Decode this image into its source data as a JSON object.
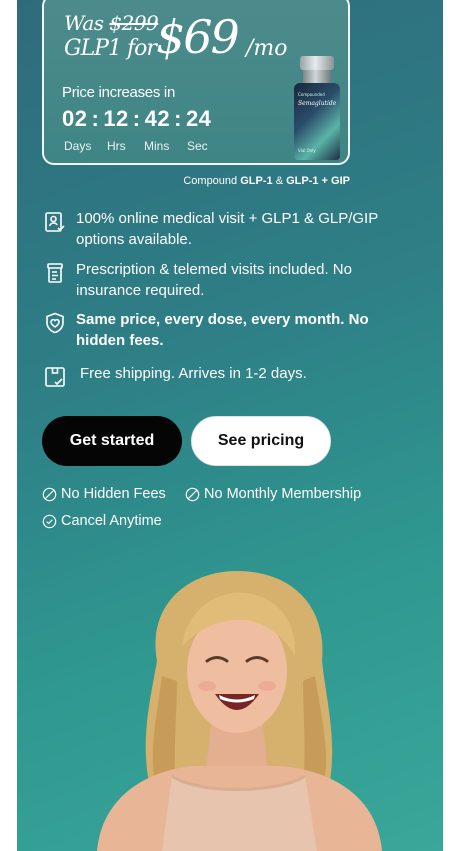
{
  "promo": {
    "was_label": "Was",
    "old_price": "$299",
    "product": "GLP1 for",
    "price": "$69",
    "period": "/mo",
    "increase_label": "Price increases in",
    "timer": {
      "days": "02",
      "hours": "12",
      "mins": "42",
      "secs": "24",
      "separator": ":",
      "labels": {
        "days": "Days",
        "hours": "Hrs",
        "mins": "Mins",
        "secs": "Sec"
      }
    },
    "vial": {
      "brand": "Compounded",
      "name": "Semaglutide",
      "footer": "Vial Only"
    }
  },
  "compound_note": {
    "prefix": "Compound",
    "first": "GLP-1",
    "amp": "&",
    "second": "GLP-1 + GIP"
  },
  "features": [
    {
      "icon": "doctor-badge-icon",
      "text": "100% online medical visit + GLP1 & GLP/GIP options available."
    },
    {
      "icon": "prescription-bottle-icon",
      "text": "Prescription & telemed visits included. No insurance required."
    },
    {
      "icon": "heart-shield-icon",
      "text": "Same price, every dose, every month. No hidden fees."
    },
    {
      "icon": "package-check-icon",
      "text": "Free shipping. Arrives in 1-2 days."
    }
  ],
  "cta": {
    "primary": "Get started",
    "secondary": "See pricing"
  },
  "perks": [
    {
      "icon": "no-sign-icon",
      "text": "No Hidden Fees"
    },
    {
      "icon": "no-sign-icon",
      "text": "No Monthly Membership"
    },
    {
      "icon": "check-circle-icon",
      "text": "Cancel Anytime"
    }
  ],
  "colors": {
    "panel_teal": "#2f8a88",
    "button_dark": "#050505",
    "card_border": "#ffffff"
  }
}
